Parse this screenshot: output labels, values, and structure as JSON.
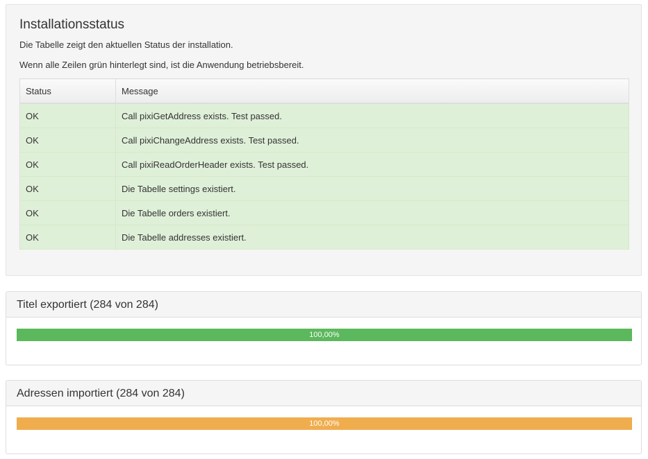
{
  "install": {
    "title": "Installationsstatus",
    "description": "Die Tabelle zeigt den aktuellen Status der installation.",
    "hint": "Wenn alle Zeilen grün hinterlegt sind, ist die Anwendung betriebsbereit.",
    "columns": [
      "Status",
      "Message"
    ],
    "rows": [
      {
        "status": "OK",
        "message": "Call pixiGetAddress exists. Test passed."
      },
      {
        "status": "OK",
        "message": "Call pixiChangeAddress exists. Test passed."
      },
      {
        "status": "OK",
        "message": "Call pixiReadOrderHeader exists. Test passed."
      },
      {
        "status": "OK",
        "message": "Die Tabelle settings existiert."
      },
      {
        "status": "OK",
        "message": "Die Tabelle orders existiert."
      },
      {
        "status": "OK",
        "message": "Die Tabelle addresses existiert."
      }
    ],
    "row_color": "#dff0d8"
  },
  "export_panel": {
    "title": "Titel exportiert (284 von 284)",
    "progress_percent": 100,
    "progress_label": "100,00%",
    "bar_color": "#5cb85c"
  },
  "import_panel": {
    "title": "Adressen importiert (284 von 284)",
    "progress_percent": 100,
    "progress_label": "100,00%",
    "bar_color": "#f0ad4e"
  }
}
